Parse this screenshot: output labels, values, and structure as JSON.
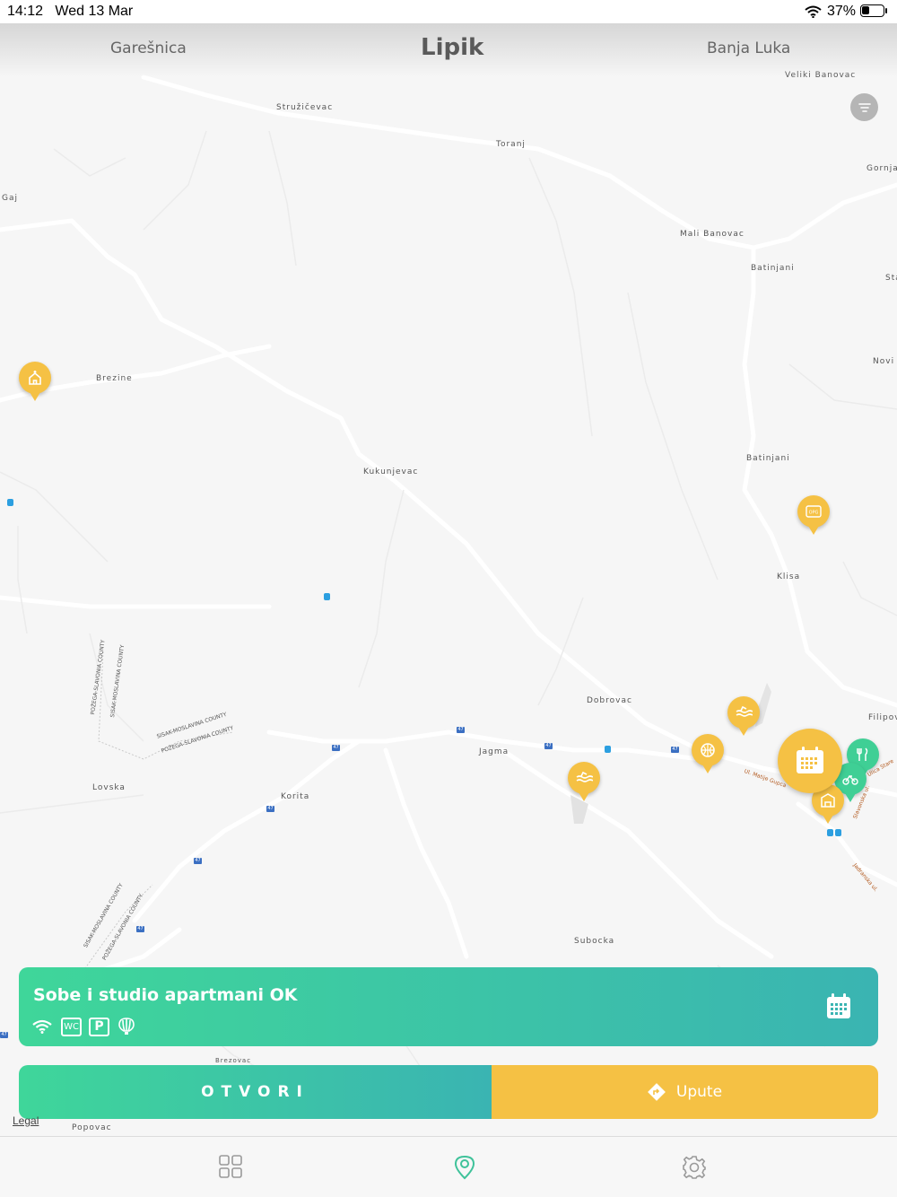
{
  "status_bar": {
    "time": "14:12",
    "date": "Wed 13 Mar",
    "battery": "37%"
  },
  "header": {
    "left_city": "Garešnica",
    "current_city": "Lipik",
    "right_city": "Banja Luka"
  },
  "map": {
    "places": [
      "Veliki Banovac",
      "Stružičevac",
      "Toranj",
      "Gornja",
      "Gaj",
      "Mali Banovac",
      "Batinjani",
      "Sta",
      "Brezine",
      "Novi I",
      "Kukunjevac",
      "Batinjani",
      "Klisa",
      "Dobrovac",
      "Filipov",
      "Jagma",
      "Lovska",
      "Korita",
      "Subocka",
      "Popovac",
      "Brezovac"
    ],
    "county_labels": [
      "POŽEGA-SLAVONIA COUNTY",
      "SISAK-MOSLAVINA COUNTY",
      "SISAK-MOSLAVINA COUNTY",
      "POŽEGA-SLAVONIA COUNTY",
      "SISAK-MOSLAVINA COUNTY",
      "POŽEGA-SLAVONIA COUNTY"
    ],
    "road_number": "47",
    "street_labels": [
      "Ul. Matije Gupca",
      "Slavonska ul.",
      "Jadranska ul.",
      "Kralja Tomislava",
      "Ulica Stare"
    ]
  },
  "card": {
    "title": "Sobe i studio apartmani OK",
    "amenities": [
      "wifi-icon",
      "wc-icon",
      "parking-icon",
      "balloon-icon"
    ],
    "wc_label": "WC",
    "parking_label": "P"
  },
  "actions": {
    "open_label": "OTVORI",
    "route_label": "Upute"
  },
  "legal": "Legal",
  "tabs": [
    "grid-icon",
    "map-pin-icon",
    "settings-icon"
  ],
  "colors": {
    "yellow": "#f5c144",
    "green_start": "#3fd69a",
    "green_end": "#3ab4b2",
    "active_tab": "#3fc29a"
  }
}
